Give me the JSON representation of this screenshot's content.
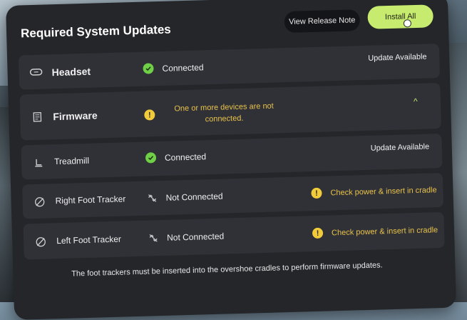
{
  "header": {
    "title": "Required System Updates",
    "release_note_label": "View Release Note",
    "install_all_label": "Install All"
  },
  "devices": [
    {
      "name": "Headset",
      "icon": "headset-icon",
      "status": "Connected",
      "status_icon": "check-icon",
      "right": "Update Available"
    },
    {
      "name": "Firmware",
      "icon": "firmware-icon",
      "status": "One or more devices are not connected.",
      "status_icon": "warning-icon",
      "right": ""
    },
    {
      "name": "Treadmill",
      "icon": "treadmill-icon",
      "status": "Connected",
      "status_icon": "check-icon",
      "right": "Update Available"
    },
    {
      "name": "Right Foot Tracker",
      "icon": "tracker-off-icon",
      "status": "Not Connected",
      "status_icon": "unlink-icon",
      "right": "Check power & insert in cradle"
    },
    {
      "name": "Left Foot Tracker",
      "icon": "tracker-off-icon",
      "status": "Not Connected",
      "status_icon": "unlink-icon",
      "right": "Check power & insert in cradle"
    }
  ],
  "footer": {
    "note": "The foot trackers must be inserted into the overshoe cradles to perform firmware updates."
  },
  "colors": {
    "accent": "#c6eb6e",
    "success": "#6fcf47",
    "warning": "#e9c24a",
    "panel": "#24262a",
    "row": "#2f3137"
  }
}
